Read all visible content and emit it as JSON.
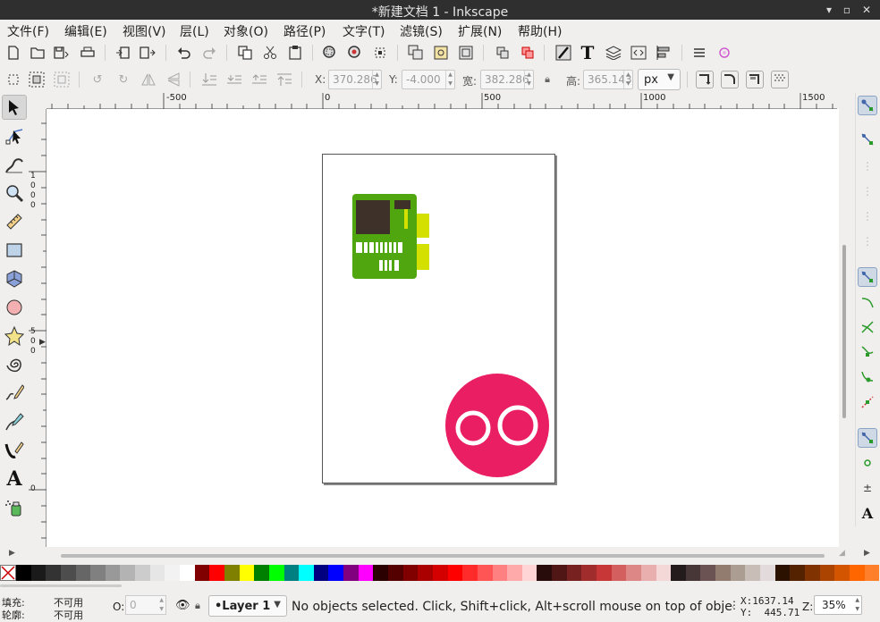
{
  "window": {
    "title": "*新建文档 1 - Inkscape",
    "minimize": "▾",
    "maximize": "▫",
    "close": "✕"
  },
  "menu": [
    "文件(F)",
    "编辑(E)",
    "视图(V)",
    "层(L)",
    "对象(O)",
    "路径(P)",
    "文字(T)",
    "滤镜(S)",
    "扩展(N)",
    "帮助(H)"
  ],
  "selectbar": {
    "x_label": "X:",
    "x_value": "370.286",
    "y_label": "Y:",
    "y_value": "-4.000",
    "w_label": "宽:",
    "w_value": "382.286",
    "h_label": "高:",
    "h_value": "365.143",
    "unit": "px"
  },
  "ruler": {
    "h_ticks": [
      "-500",
      "0",
      "500",
      "1000",
      "1500"
    ],
    "v_ticks": [
      "1\n0\n0\n0",
      "5\n0\n0",
      "0"
    ]
  },
  "canvas": {
    "board_color": "#4fa60f",
    "board_chip": "#3d3129",
    "connector_color": "#d4e000",
    "circle_color": "#e91e63"
  },
  "palette": [
    "#000000",
    "#1a1a1a",
    "#333333",
    "#4d4d4d",
    "#666666",
    "#808080",
    "#999999",
    "#b3b3b3",
    "#cccccc",
    "#e6e6e6",
    "#f2f2f2",
    "#ffffff",
    "#800000",
    "#ff0000",
    "#808000",
    "#ffff00",
    "#008000",
    "#00ff00",
    "#008080",
    "#00ffff",
    "#000080",
    "#0000ff",
    "#800080",
    "#ff00ff",
    "#2b0000",
    "#550000",
    "#800000",
    "#aa0000",
    "#d40000",
    "#ff0000",
    "#ff2a2a",
    "#ff5555",
    "#ff8080",
    "#ffaaaa",
    "#ffd5d5",
    "#280b0b",
    "#501616",
    "#782121",
    "#a02c2c",
    "#c83737",
    "#d35f5f",
    "#de8787",
    "#e9afaf",
    "#f4d7d7",
    "#241c1c",
    "#483737",
    "#6c5353",
    "#917c6f",
    "#ac9d93",
    "#c8beb7",
    "#e3dbdb",
    "#2b1100",
    "#552200",
    "#803300",
    "#aa4400",
    "#d45500",
    "#ff6600",
    "#ff7f2a"
  ],
  "status": {
    "fill_label": "填充:",
    "fill_value": "不可用",
    "stroke_label": "轮廓:",
    "stroke_value": "不可用",
    "opacity_label": "O:",
    "opacity_value": "0",
    "layer": "•Layer 1",
    "message": "No objects selected. Click, Shift+click, Alt+scroll mouse on top of objects, or drag around objects to select.",
    "x_coord": "X:1637.14",
    "y_coord": "Y:  445.71",
    "zoom_label": "Z:",
    "zoom_value": "35%"
  }
}
